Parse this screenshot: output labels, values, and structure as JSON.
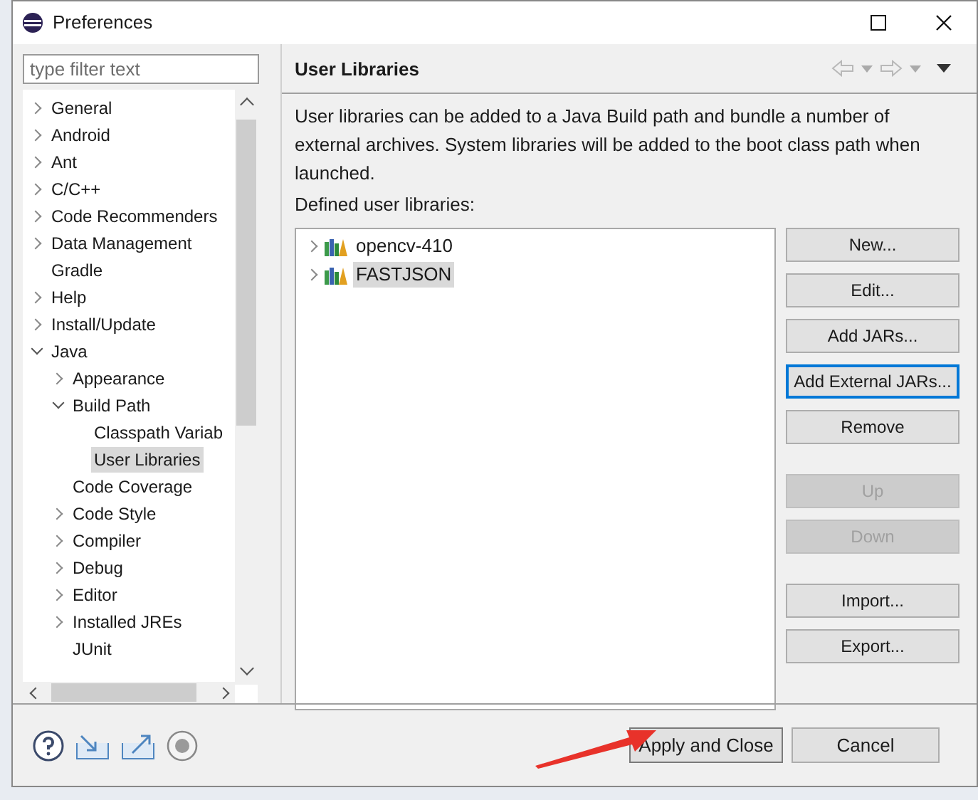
{
  "window": {
    "title": "Preferences"
  },
  "filter": {
    "placeholder": "type filter text"
  },
  "tree": [
    {
      "label": "General",
      "expanded": false,
      "selected": false
    },
    {
      "label": "Android",
      "expanded": false,
      "selected": false
    },
    {
      "label": "Ant",
      "expanded": false,
      "selected": false
    },
    {
      "label": "C/C++",
      "expanded": false,
      "selected": false
    },
    {
      "label": "Code Recommenders",
      "expanded": false,
      "selected": false
    },
    {
      "label": "Data Management",
      "expanded": false,
      "selected": false
    },
    {
      "label": "Gradle",
      "selected": false
    },
    {
      "label": "Help",
      "expanded": false,
      "selected": false
    },
    {
      "label": "Install/Update",
      "expanded": false,
      "selected": false
    },
    {
      "label": "Java",
      "expanded": true,
      "selected": false,
      "children": [
        {
          "label": "Appearance",
          "expanded": false,
          "selected": false
        },
        {
          "label": "Build Path",
          "expanded": true,
          "selected": false,
          "children": [
            {
              "label": "Classpath Variab",
              "selected": false
            },
            {
              "label": "User Libraries",
              "selected": true
            }
          ]
        },
        {
          "label": "Code Coverage",
          "selected": false
        },
        {
          "label": "Code Style",
          "expanded": false,
          "selected": false
        },
        {
          "label": "Compiler",
          "expanded": false,
          "selected": false
        },
        {
          "label": "Debug",
          "expanded": false,
          "selected": false
        },
        {
          "label": "Editor",
          "expanded": false,
          "selected": false
        },
        {
          "label": "Installed JREs",
          "expanded": false,
          "selected": false
        },
        {
          "label": "JUnit",
          "selected": false
        }
      ]
    }
  ],
  "page": {
    "title": "User Libraries",
    "description": "User libraries can be added to a Java Build path and bundle a number of external archives. System libraries will be added to the boot class path when launched.",
    "list_label": "Defined user libraries:"
  },
  "libraries": [
    {
      "name": "opencv-410",
      "selected": false
    },
    {
      "name": "FASTJSON",
      "selected": true
    }
  ],
  "button_groups": [
    [
      {
        "label": "New...",
        "disabled": false,
        "focused": false
      },
      {
        "label": "Edit...",
        "disabled": false,
        "focused": false
      },
      {
        "label": "Add JARs...",
        "disabled": false,
        "focused": false
      },
      {
        "label": "Add External JARs...",
        "disabled": false,
        "focused": true
      },
      {
        "label": "Remove",
        "disabled": false,
        "focused": false
      }
    ],
    [
      {
        "label": "Up",
        "disabled": true,
        "focused": false
      },
      {
        "label": "Down",
        "disabled": true,
        "focused": false
      }
    ],
    [
      {
        "label": "Import...",
        "disabled": false,
        "focused": false
      },
      {
        "label": "Export...",
        "disabled": false,
        "focused": false
      }
    ]
  ],
  "dialog_buttons": [
    {
      "label": "Apply and Close",
      "default": true
    },
    {
      "label": "Cancel",
      "default": false
    }
  ],
  "annotation": {
    "kind": "arrow"
  }
}
